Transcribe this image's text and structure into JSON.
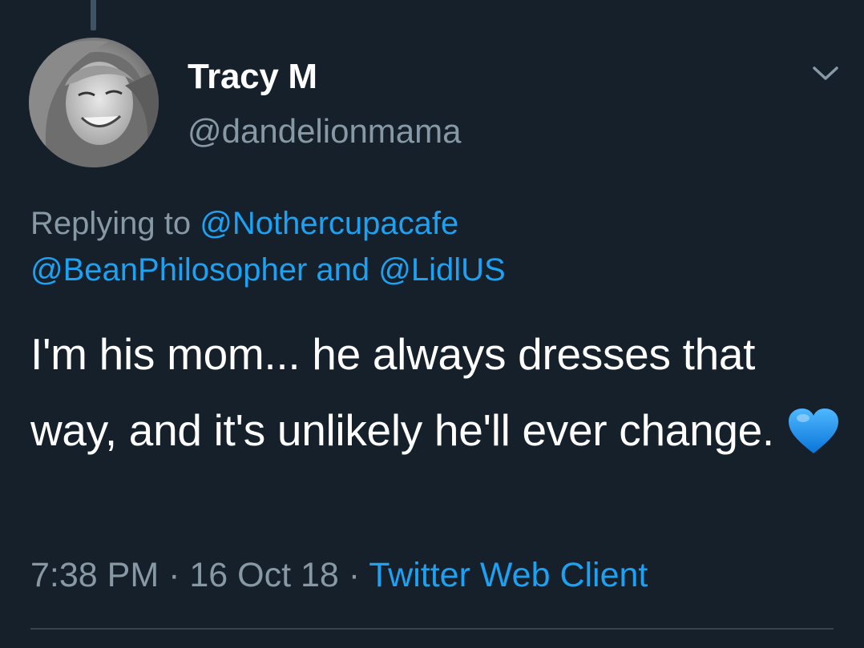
{
  "tweet": {
    "author": {
      "display_name": "Tracy M",
      "handle": "@dandelionmama",
      "avatar_icon": "profile-photo"
    },
    "reply_context": {
      "prefix": "Replying to",
      "mention_1": "@Nothercupacafe",
      "mention_2": "@BeanPhilosopher",
      "conjunction": "and",
      "mention_3": "@LidlUS"
    },
    "text": "I'm his mom... he always dresses that way, and it's unlikely he'll ever change.",
    "emoji": "blue-heart",
    "meta": {
      "time": "7:38 PM",
      "separator": "·",
      "date": "16 Oct 18",
      "source": "Twitter Web Client"
    },
    "more_icon": "chevron-down-icon"
  },
  "colors": {
    "background": "#15202b",
    "text_primary": "#ffffff",
    "text_secondary": "#8899a6",
    "accent": "#1da1f2",
    "emoji_blue": "#1e90ff"
  }
}
